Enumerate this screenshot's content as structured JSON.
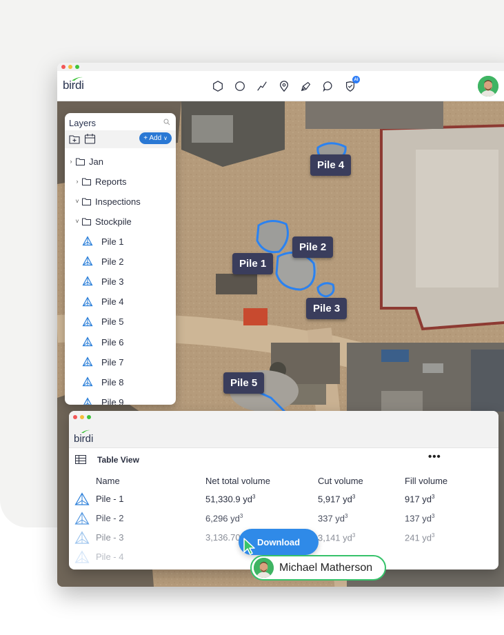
{
  "brand": {
    "logo_text": "birdi",
    "accent": "#3ec43b"
  },
  "toolbar": {
    "tools": [
      {
        "name": "polygon-tool-icon"
      },
      {
        "name": "circle-tool-icon"
      },
      {
        "name": "line-tool-icon"
      },
      {
        "name": "pin-tool-icon"
      },
      {
        "name": "pen-tool-icon"
      },
      {
        "name": "comment-tool-icon"
      },
      {
        "name": "ai-shield-tool-icon",
        "badge": "AI"
      }
    ]
  },
  "map": {
    "pile_labels": [
      "Pile 4",
      "Pile 2",
      "Pile 1",
      "Pile 3",
      "Pile 5"
    ]
  },
  "layers": {
    "title": "Layers",
    "add_label": "+ Add",
    "folders": [
      {
        "label": "Jan",
        "chevron": "›"
      },
      {
        "label": "Reports",
        "chevron": "›"
      },
      {
        "label": "Inspections",
        "chevron": "˅"
      },
      {
        "label": "Stockpile",
        "chevron": "˅"
      }
    ],
    "piles": [
      "Pile 1",
      "Pile 2",
      "Pile 3",
      "Pile 4",
      "Pile 5",
      "Pile 6",
      "Pile 7",
      "Pile 8",
      "Pile 9"
    ]
  },
  "table": {
    "logo_text": "birdi",
    "view_label": "Table View",
    "more": "•••",
    "columns": [
      "Name",
      "Net total volume",
      "Cut volume",
      "Fill volume"
    ],
    "rows": [
      {
        "name": "Pile - 1",
        "net": "51,330.9 yd",
        "cut": "5,917 yd",
        "fill": "917 yd"
      },
      {
        "name": "Pile - 2",
        "net": "6,296 yd",
        "cut": "337 yd",
        "fill": "137 yd"
      },
      {
        "name": "Pile - 3",
        "net": "3,136.70",
        "cut": "3,141 yd",
        "fill": "241 yd"
      },
      {
        "name": "Pile - 4",
        "net": "",
        "cut": "",
        "fill": ""
      }
    ],
    "unit_sup": "3"
  },
  "download": {
    "label": "Download"
  },
  "user": {
    "name": "Michael Matherson"
  }
}
